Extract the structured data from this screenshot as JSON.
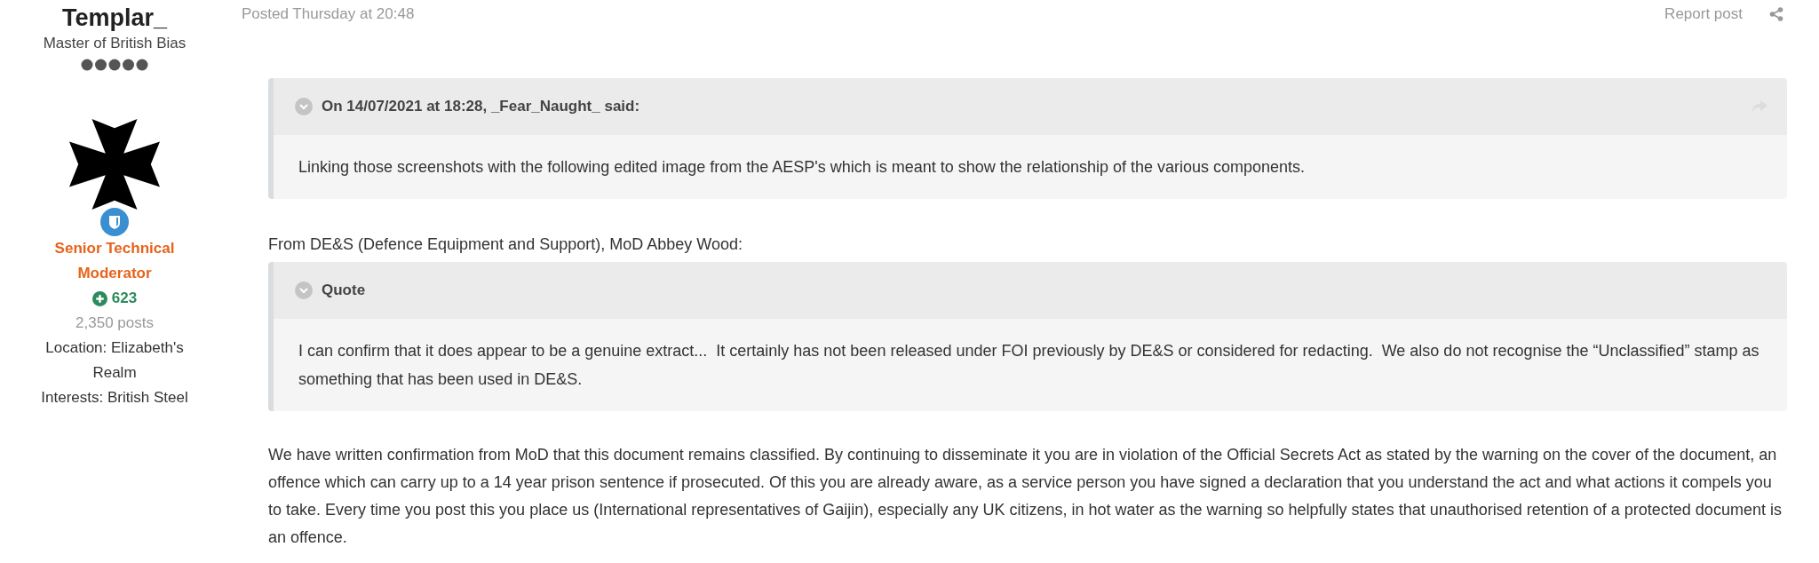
{
  "author": {
    "name": "Templar_",
    "title": "Master of British Bias",
    "group": "Senior Technical Moderator",
    "reputation": "623",
    "posts": "2,350 posts",
    "fields": [
      "Location: Elizabeth's Realm",
      "Interests: British Steel"
    ]
  },
  "post": {
    "posted": "Posted Thursday at 20:48",
    "report": "Report post",
    "content": [
      {
        "kind": "quote",
        "header": "On 14/07/2021 at 18:28, _Fear_Naught_ said:",
        "share": true,
        "text": "Linking those screenshots with the following edited image from the AESP's which is meant to show the relationship of the various components."
      },
      {
        "kind": "paragraph",
        "text": "From DE&S (Defence Equipment and Support), MoD Abbey Wood:"
      },
      {
        "kind": "quote",
        "header": "Quote",
        "share": false,
        "text": "I can confirm that it does appear to be a genuine extract...  It certainly has not been released under FOI previously by DE&S or considered for redacting.  We also do not recognise the “Unclassified” stamp as something that has been used in DE&S."
      },
      {
        "kind": "paragraph",
        "text": "We have written confirmation from MoD that this document remains classified. By continuing to disseminate it you are in violation of the Official Secrets Act as stated by the warning on the cover of the document, an offence which can carry up to a 14 year prison sentence if prosecuted. Of this you are already aware, as a service person you have signed a declaration that you understand the act and what actions it compels you to take. Every time you post this you place us (International representatives of Gaijin), especially any UK citizens, in hot water as the warning so helpfully states that unauthorised retention of a protected document is an offence."
      }
    ]
  }
}
